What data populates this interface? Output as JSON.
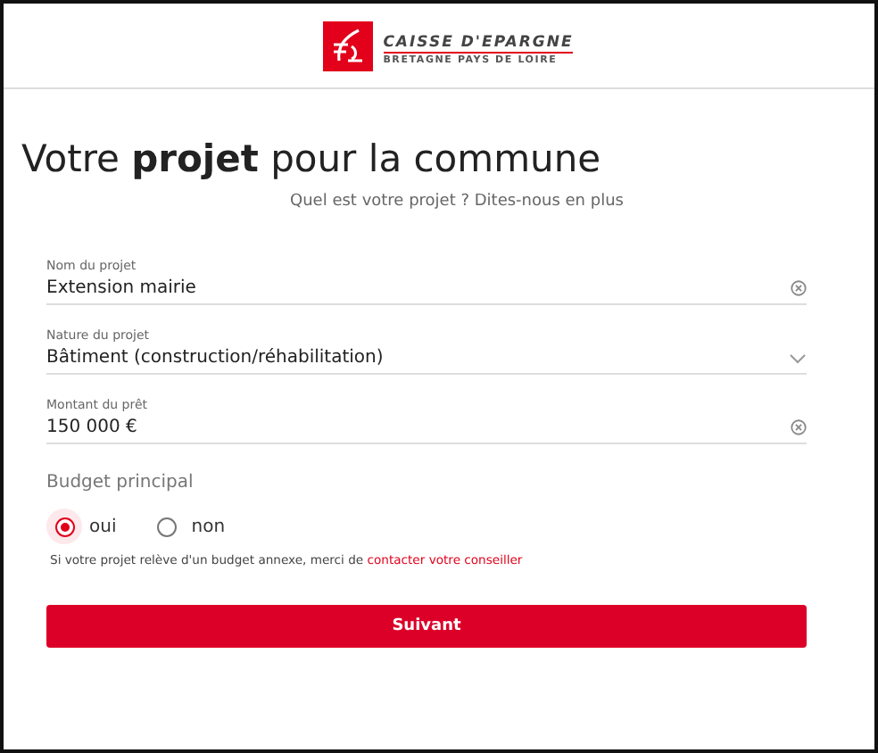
{
  "header": {
    "brand_name": "CAISSE D'EPARGNE",
    "brand_region": "BRETAGNE PAYS DE LOIRE"
  },
  "title": "Votre **projet** pour la commune",
  "subtitle": "Quel est votre projet ? Dites-nous en plus",
  "fields": [
    {
      "kind": "text",
      "label": "Nom du projet",
      "value": "Extension mairie"
    },
    {
      "kind": "select",
      "label": "Nature du projet",
      "value": "Bâtiment (construction/réhabilitation)"
    },
    {
      "kind": "text",
      "label": "Montant du prêt",
      "value": "150 000 €"
    }
  ],
  "budget": {
    "label": "Budget principal",
    "options": [
      {
        "label": "oui",
        "selected": true
      },
      {
        "label": "non",
        "selected": false
      }
    ]
  },
  "note": {
    "text": "Si votre projet relève d'un budget annexe, merci de",
    "link": "contacter votre conseiller"
  },
  "button": "Suivant"
}
